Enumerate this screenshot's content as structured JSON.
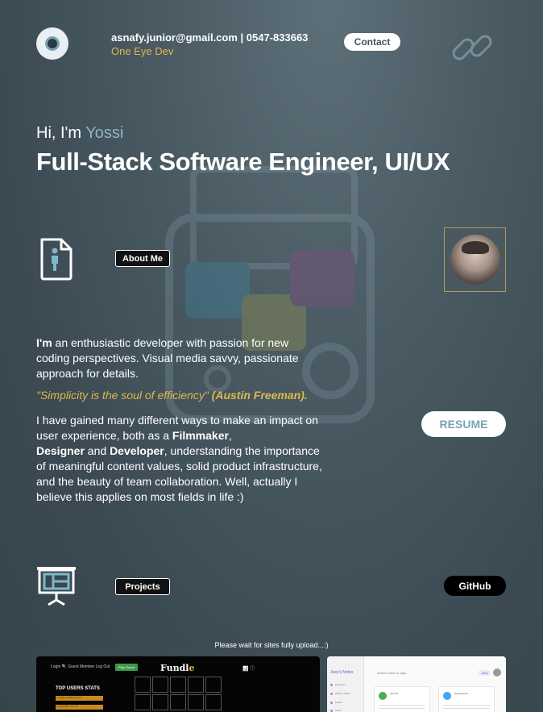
{
  "header": {
    "contact_line": "asnafy.junior@gmail.com | 0547-833663",
    "brand": "One Eye Dev",
    "contact_button": "Contact",
    "logo_icon": "eye-logo-icon",
    "share_icon": "link-chain-icon"
  },
  "hero": {
    "greeting_prefix": "Hi, I'm ",
    "greeting_name": "Yossi",
    "headline": "Full-Stack Software Engineer, UI/UX"
  },
  "about": {
    "section_label": "About Me",
    "icon": "document-person-icon",
    "intro_bold": "I'm",
    "intro_text": " an enthusiastic developer with passion for new coding perspectives. Visual media savvy, passionate approach for details.",
    "quote_text": "\"Simplicity is the soul of efficiency\"",
    "quote_author": " (Austin Freeman).",
    "body_1": "I have gained many different ways to make an impact on user experience, both as a ",
    "body_filmmaker": "Filmmaker",
    "body_2": ",",
    "body_designer": "Designer",
    "body_3": " and ",
    "body_developer": "Developer",
    "body_4": ", understanding the importance of meaningful content values, solid product infrastructure, and the beauty of team collaboration. Well, actually I believe this applies on most fields in life :)",
    "resume_button": "RESUME"
  },
  "projects": {
    "section_label": "Projects",
    "icon": "projector-board-icon",
    "github_button": "GitHub",
    "wait_note": "Please wait for sites fully upload...:)",
    "fundle": {
      "nav": "Login 🔍   Guest Member   Log Out",
      "nav_button": "Play Game",
      "title_main": "Fundl",
      "title_accent": "e",
      "icons": "📊  ⓘ",
      "stats_title": "TOP USERS STATS",
      "stat_1": "1. snarfy        12345 / 14 / 10",
      "stat_2": "2. avi            10700 / 12 / 11"
    },
    "notes": {
      "app_title": "Joey's Notes",
      "nav_items": [
        "My Notes",
        "Archive Notes",
        "Labels",
        "Trash"
      ],
      "search": "Search notes & tags",
      "user": "Joey",
      "card_1_title": "Journal",
      "card_2_title": "Shopping list"
    }
  },
  "colors": {
    "accent_gold": "#e0b84a",
    "accent_blue": "#8fb6c6",
    "background": "#3f4e56"
  }
}
